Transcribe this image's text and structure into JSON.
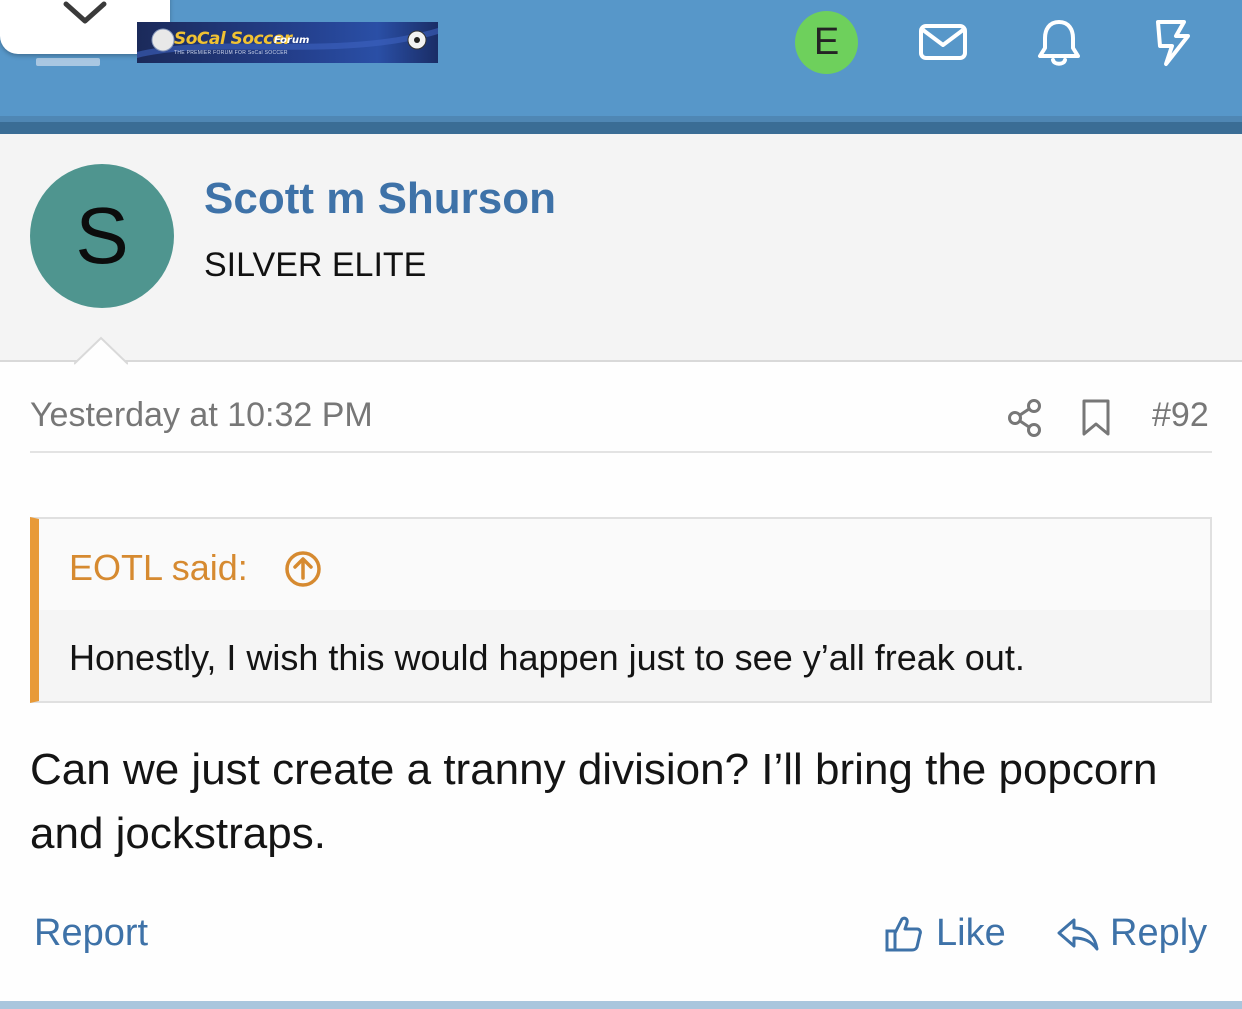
{
  "header": {
    "logo": {
      "brand": "SoCal Soccer",
      "suffix": "Forum",
      "tagline": "THE PREMIER FORUM FOR SoCal SOCCER"
    },
    "account_initial": "E",
    "icons": [
      "chevron-down-icon",
      "menu-icon",
      "mail-icon",
      "bell-icon",
      "lightning-icon"
    ],
    "colors": {
      "bar": "#5797c9",
      "account_avatar": "#6ed05c"
    }
  },
  "user": {
    "initial": "S",
    "name": "Scott m Shurson",
    "title": "SILVER ELITE",
    "avatar_color": "#4f958f"
  },
  "post": {
    "date": "Yesterday at 10:32 PM",
    "number": "#92",
    "quote": {
      "author": "EOTL said:",
      "text": "Honestly, I wish this would happen just to see y’all freak out."
    },
    "body": "Can we just create a tranny division? I’ll bring the popcorn and jockstraps."
  },
  "actions": {
    "report": "Report",
    "like": "Like",
    "reply": "Reply"
  }
}
